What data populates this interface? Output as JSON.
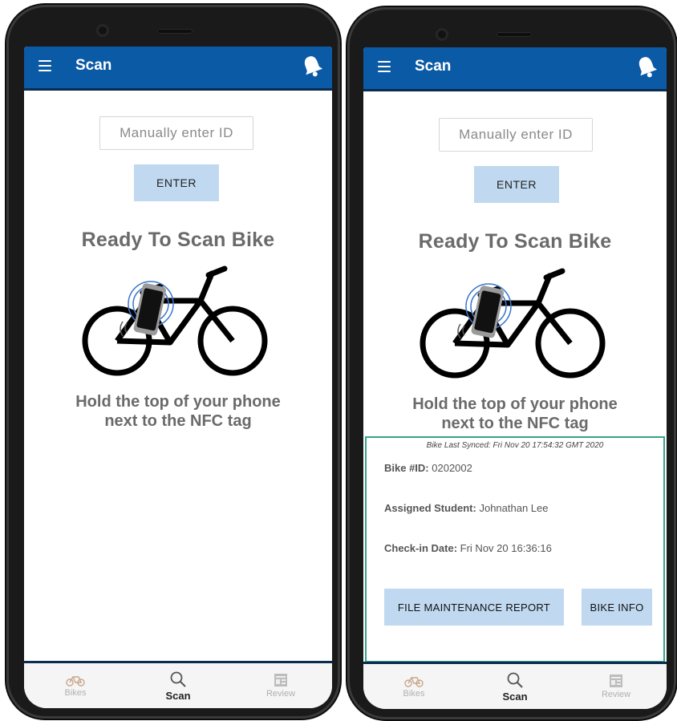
{
  "screens": [
    {
      "app_bar": {
        "title": "Scan"
      },
      "input": {
        "placeholder": "Manually enter ID"
      },
      "enter_label": "ENTER",
      "ready_title": "Ready To Scan Bike",
      "hold_text_line1": "Hold the top of your phone",
      "hold_text_line2": "next to the NFC tag",
      "nav": [
        {
          "label": "Bikes",
          "icon": "bike-icon"
        },
        {
          "label": "Scan",
          "icon": "search-icon",
          "active": true
        },
        {
          "label": "Review",
          "icon": "review-icon"
        }
      ]
    },
    {
      "app_bar": {
        "title": "Scan"
      },
      "input": {
        "placeholder": "Manually enter ID"
      },
      "enter_label": "ENTER",
      "ready_title": "Ready To Scan Bike",
      "hold_text_line1": "Hold the top of your phone",
      "hold_text_line2": "next to the NFC tag",
      "panel": {
        "synced": "Bike Last Synced: Fri Nov 20 17:54:32 GMT 2020",
        "bike_id_label": "Bike #ID:",
        "bike_id_value": "0202002",
        "student_label": "Assigned Student:",
        "student_value": "Johnathan Lee",
        "checkin_label": "Check-in Date:",
        "checkin_value": "Fri Nov 20 16:36:16",
        "maintenance_button": "FILE MAINTENANCE REPORT",
        "info_button": "BIKE INFO"
      },
      "nav": [
        {
          "label": "Bikes",
          "icon": "bike-icon"
        },
        {
          "label": "Scan",
          "icon": "search-icon",
          "active": true
        },
        {
          "label": "Review",
          "icon": "review-icon"
        }
      ]
    }
  ],
  "colors": {
    "app_bar": "#0b5aa5",
    "button_bg": "#c0d9f0",
    "panel_border": "#3aa18a",
    "heading_text": "#6a6a6a"
  }
}
